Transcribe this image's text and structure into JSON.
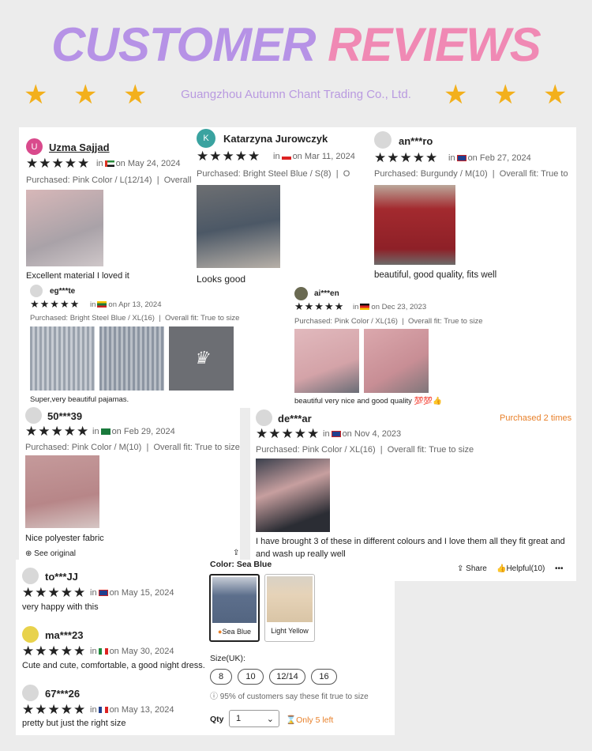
{
  "header": {
    "title_part1": "CUSTOMER",
    "title_part2": "REVIEWS",
    "company": "Guangzhou Autumn Chant Trading Co., Ltd."
  },
  "colors": {
    "title_purple": "#b692e6",
    "title_pink": "#f089b4",
    "star_gold": "#f3b01c",
    "accent_orange": "#e8802a"
  },
  "reviews": [
    {
      "initial": "U",
      "name": "Uzma Sajjad",
      "stars": "★★★★★",
      "date": "on May 24, 2024",
      "purchased": "Purchased: Pink Color / L(12/14)",
      "fit": "Overall",
      "text": "Excellent material I loved it"
    },
    {
      "initial": "K",
      "name": "Katarzyna Jurowczyk",
      "stars": "★★★★★",
      "date": "on Mar 11, 2024",
      "purchased": "Purchased: Bright Steel Blue / S(8)",
      "fit": "O",
      "text": "Looks good"
    },
    {
      "name": "an***ro",
      "stars": "★★★★★",
      "date": "on Feb 27, 2024",
      "purchased": "Purchased: Burgundy / M(10)",
      "fit": "Overall fit: True to",
      "text": "beautiful, good quality, fits well"
    },
    {
      "name": "eg***te",
      "stars": "★★★★★",
      "date": "on Apr 13, 2024",
      "purchased": "Purchased: Bright Steel Blue / XL(16)",
      "fit": "Overall fit: True to size",
      "text": "Super,very beautiful pajamas."
    },
    {
      "name": "ai***en",
      "stars": "★★★★★",
      "date": "on Dec 23, 2023",
      "purchased": "Purchased: Pink Color / XL(16)",
      "fit": "Overall fit: True to size",
      "text": "beautiful very nice and good quality 💯💯👍"
    },
    {
      "name": "50***39",
      "stars": "★★★★★",
      "date": "on Feb 29, 2024",
      "purchased": "Purchased: Pink Color / M(10)",
      "fit": "Overall fit: True to size",
      "text": "Nice polyester fabric"
    },
    {
      "name": "de***ar",
      "stars": "★★★★★",
      "date": "on Nov 4, 2023",
      "purchased": "Purchased: Pink Color / XL(16)",
      "fit": "Overall fit: True to size",
      "badge": "Purchased 2 times",
      "text1": "I have brought 3 of these in different colours and I love them all they fit great and",
      "text2": "and wash up really well"
    },
    {
      "name": "to***JJ",
      "stars": "★★★★★",
      "date": "on May 15, 2024",
      "text": "very happy with this"
    },
    {
      "name": "ma***23",
      "stars": "★★★★★",
      "date": "on May 30, 2024",
      "text": "Cute and cute, comfortable, a good night dress."
    },
    {
      "name": "67***26",
      "stars": "★★★★★",
      "date": "on May 13, 2024",
      "text": "pretty but just the right size"
    }
  ],
  "common": {
    "in": "in",
    "see_original": "See original",
    "share": "Share",
    "helpful": "Helpful(10)",
    "more": "•••"
  },
  "product": {
    "color_label": "Color: Sea Blue",
    "colors": [
      "Sea Blue",
      "Light Yellow"
    ],
    "size_label": "Size(UK):",
    "sizes": [
      "8",
      "10",
      "12/14",
      "16"
    ],
    "fit_note": "95% of customers say these fit true to size",
    "qty_label": "Qty",
    "qty_value": "1",
    "stock": "Only 5 left"
  },
  "header_stars": "★"
}
